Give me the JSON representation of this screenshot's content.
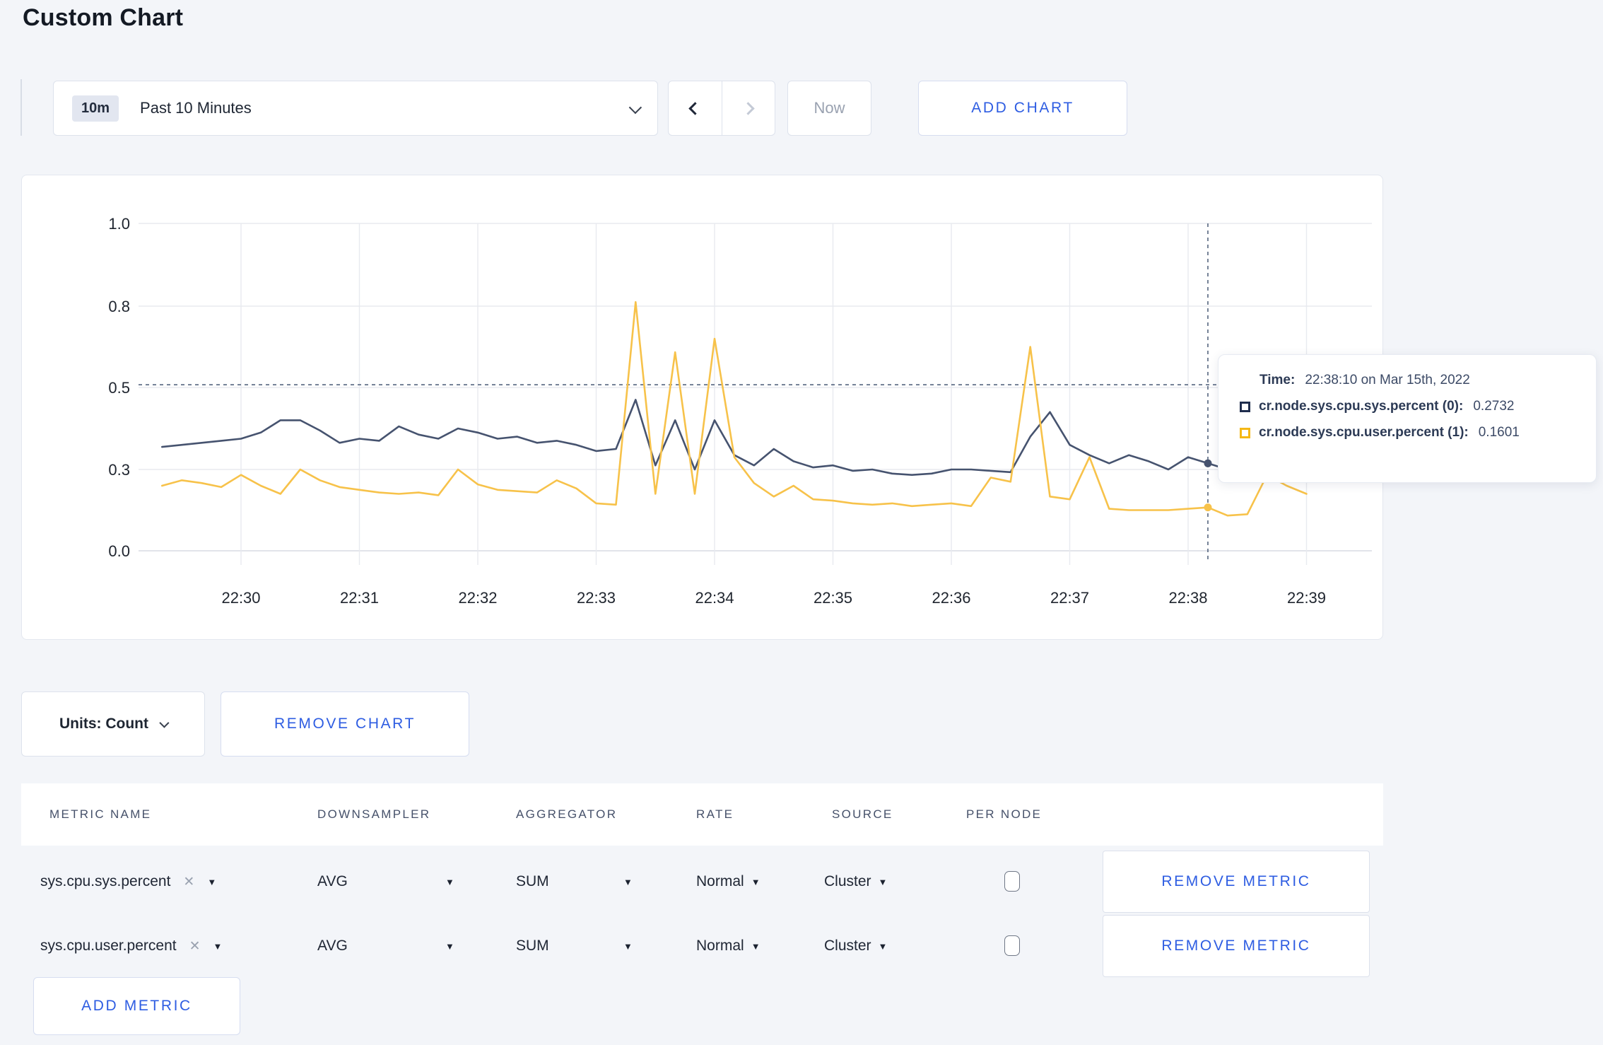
{
  "page": {
    "title": "Custom Chart"
  },
  "toolbar": {
    "time_range_badge": "10m",
    "time_range_label": "Past 10 Minutes",
    "now_label": "Now",
    "add_chart_label": "ADD CHART"
  },
  "icons": {
    "caret_down": "▼",
    "close": "✕"
  },
  "tooltip": {
    "time_label": "Time:",
    "time_value": "22:38:10 on Mar 15th, 2022",
    "series": [
      {
        "label": "cr.node.sys.cpu.sys.percent (0):",
        "value": "0.2732",
        "color": "#1f2d4d"
      },
      {
        "label": "cr.node.sys.cpu.user.percent (1):",
        "value": "0.1601",
        "color": "#f5b816"
      }
    ]
  },
  "chart_data": {
    "type": "line",
    "title": "",
    "grid": true,
    "legend_position": "none",
    "x_axis": {
      "ticks": [
        "22:30",
        "22:31",
        "22:32",
        "22:33",
        "22:34",
        "22:35",
        "22:36",
        "22:37",
        "22:38",
        "22:39"
      ]
    },
    "y_axis": {
      "ticks": [
        {
          "label": "0.0",
          "value": 0.0
        },
        {
          "label": "0.3",
          "value": 0.3
        },
        {
          "label": "0.5",
          "value": 0.5
        },
        {
          "label": "0.8",
          "value": 0.8
        },
        {
          "label": "1.0",
          "value": 1.0
        }
      ]
    },
    "x_minutes_from_22_30": [
      -0.667,
      -0.5,
      -0.333,
      -0.167,
      0,
      0.167,
      0.333,
      0.5,
      0.667,
      0.833,
      1,
      1.167,
      1.333,
      1.5,
      1.667,
      1.833,
      2,
      2.167,
      2.333,
      2.5,
      2.667,
      2.833,
      3,
      3.167,
      3.333,
      3.5,
      3.667,
      3.833,
      4,
      4.167,
      4.333,
      4.5,
      4.667,
      4.833,
      5,
      5.167,
      5.333,
      5.5,
      5.667,
      5.833,
      6,
      6.167,
      6.333,
      6.5,
      6.667,
      6.833,
      7,
      7.167,
      7.333,
      7.5,
      7.667,
      7.833,
      8,
      8.167,
      8.333,
      8.5,
      8.667,
      8.833,
      9
    ],
    "series": [
      {
        "name": "cr.node.sys.cpu.sys.percent",
        "color": "#46536f",
        "values": [
          0.355,
          0.36,
          0.365,
          0.37,
          0.375,
          0.39,
          0.42,
          0.42,
          0.395,
          0.365,
          0.375,
          0.37,
          0.405,
          0.385,
          0.375,
          0.4,
          0.39,
          0.375,
          0.38,
          0.365,
          0.37,
          0.36,
          0.345,
          0.35,
          0.47,
          0.31,
          0.42,
          0.3,
          0.42,
          0.335,
          0.31,
          0.35,
          0.32,
          0.305,
          0.31,
          0.295,
          0.3,
          0.285,
          0.28,
          0.285,
          0.3,
          0.3,
          0.295,
          0.29,
          0.38,
          0.44,
          0.36,
          0.335,
          0.315,
          0.335,
          0.32,
          0.3,
          0.33,
          0.315,
          0.3,
          0.3,
          0.31,
          0.3,
          0.305
        ]
      },
      {
        "name": "cr.node.sys.cpu.user.percent",
        "color": "#f7c24a",
        "values": [
          0.24,
          0.26,
          0.25,
          0.235,
          0.28,
          0.24,
          0.21,
          0.3,
          0.26,
          0.235,
          0.225,
          0.215,
          0.21,
          0.215,
          0.205,
          0.3,
          0.245,
          0.225,
          0.22,
          0.215,
          0.26,
          0.23,
          0.175,
          0.17,
          0.81,
          0.21,
          0.63,
          0.21,
          0.68,
          0.33,
          0.25,
          0.2,
          0.24,
          0.19,
          0.185,
          0.175,
          0.17,
          0.175,
          0.165,
          0.17,
          0.175,
          0.165,
          0.27,
          0.255,
          0.65,
          0.2,
          0.19,
          0.33,
          0.155,
          0.15,
          0.15,
          0.15,
          0.155,
          0.16,
          0.13,
          0.135,
          0.28,
          0.24,
          0.21
        ]
      }
    ],
    "crosshair": {
      "time": "22:38:10",
      "x_minutes_from_22_30": 8.167,
      "hline_value": 0.51,
      "highlighted": [
        {
          "series": "cr.node.sys.cpu.sys.percent",
          "value": 0.2732
        },
        {
          "series": "cr.node.sys.cpu.user.percent",
          "value": 0.1601
        }
      ]
    }
  },
  "chart_footer": {
    "units_label": "Units: Count",
    "remove_chart_label": "REMOVE CHART"
  },
  "metrics_table": {
    "headers": [
      "METRIC NAME",
      "DOWNSAMPLER",
      "AGGREGATOR",
      "RATE",
      "SOURCE",
      "PER NODE"
    ],
    "rows": [
      {
        "metric_name": "sys.cpu.sys.percent",
        "downsampler": "AVG",
        "aggregator": "SUM",
        "rate": "Normal",
        "source": "Cluster",
        "per_node_checked": false,
        "remove_label": "REMOVE METRIC"
      },
      {
        "metric_name": "sys.cpu.user.percent",
        "downsampler": "AVG",
        "aggregator": "SUM",
        "rate": "Normal",
        "source": "Cluster",
        "per_node_checked": false,
        "remove_label": "REMOVE METRIC"
      }
    ],
    "add_metric_label": "ADD METRIC"
  }
}
